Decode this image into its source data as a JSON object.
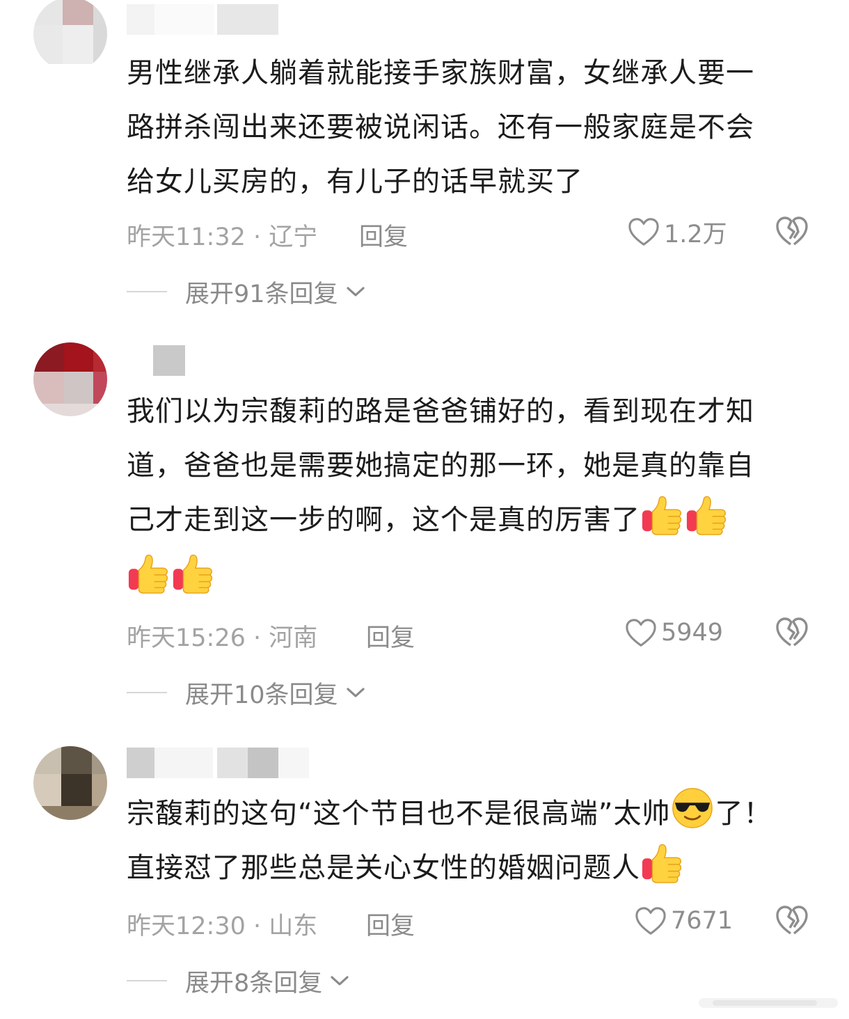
{
  "colors": {
    "text": "#1c1c1c",
    "meta": "#a3a3a3",
    "accent_icon": "#8d8d8d"
  },
  "comments": [
    {
      "lines": [
        "男性继承人躺着就能接手家族财富，女继承人要一",
        "路拼杀闯出来还要被说闲话。还有一般家庭是不会",
        "给女儿买房的，有儿子的话早就买了"
      ],
      "time": "昨天11:32 · 辽宁",
      "reply": "回复",
      "likes": "1.2万",
      "expand": "展开91条回复"
    },
    {
      "lines": [
        "我们以为宗馥莉的路是爸爸铺好的，看到现在才知",
        "道，爸爸也是需要她搞定的那一环，她是真的靠自",
        "己才走到这一步的啊，这个是真的厉害了"
      ],
      "emoji_icon": "thumbs-up-icon",
      "time": "昨天15:26 · 河南",
      "reply": "回复",
      "likes": "5949",
      "expand": "展开10条回复"
    },
    {
      "line1_a": "宗馥莉的这句“这个节目也不是很高端”太帅",
      "line1_b": "了！",
      "line2": "直接怼了那些总是关心女性的婚姻问题人",
      "emoji_icon_1": "sunglasses-face-icon",
      "emoji_icon_2": "thumbs-up-icon",
      "time": "昨天12:30 · 山东",
      "reply": "回复",
      "likes": "7671",
      "expand": "展开8条回复"
    }
  ]
}
